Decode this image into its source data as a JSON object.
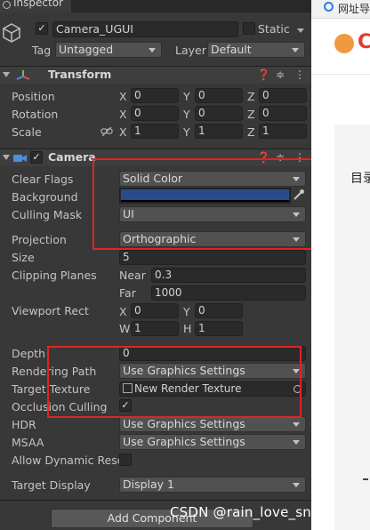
{
  "inspector": {
    "tab_label": "Inspector"
  },
  "object": {
    "name": "Camera_UGUI",
    "static_label": "Static",
    "tag_label": "Tag",
    "tag_value": "Untagged",
    "layer_label": "Layer",
    "layer_value": "Default"
  },
  "transform": {
    "title": "Transform",
    "position_label": "Position",
    "rotation_label": "Rotation",
    "scale_label": "Scale",
    "x": "X",
    "y": "Y",
    "z": "Z",
    "position": [
      "0",
      "0",
      "0"
    ],
    "rotation": [
      "0",
      "0",
      "0"
    ],
    "scale": [
      "1",
      "1",
      "1"
    ]
  },
  "camera": {
    "title": "Camera",
    "clear_flags_label": "Clear Flags",
    "clear_flags": "Solid Color",
    "background_label": "Background",
    "background_color": "#2b4a8b",
    "culling_mask_label": "Culling Mask",
    "culling_mask": "UI",
    "projection_label": "Projection",
    "projection": "Orthographic",
    "size_label": "Size",
    "size": "5",
    "clipping_label": "Clipping Planes",
    "near_label": "Near",
    "near": "0.3",
    "far_label": "Far",
    "far": "1000",
    "viewport_label": "Viewport Rect",
    "vx": "0",
    "vy": "0",
    "vw_label": "W",
    "vw": "1",
    "vh_label": "H",
    "vh": "1",
    "depth_label": "Depth",
    "depth": "0",
    "rendering_path_label": "Rendering Path",
    "rendering_path": "Use Graphics Settings",
    "target_texture_label": "Target Texture",
    "target_texture": "New Render Texture",
    "occlusion_label": "Occlusion Culling",
    "hdr_label": "HDR",
    "hdr": "Use Graphics Settings",
    "msaa_label": "MSAA",
    "msaa": "Use Graphics Settings",
    "dynamic_label": "Allow Dynamic Resol",
    "target_display_label": "Target Display",
    "target_display": "Display 1"
  },
  "add_component": "Add Component",
  "watermark": "CSDN @rain_love_snow",
  "browser": {
    "tab_text": "网址导",
    "logo_letter": "C",
    "toc_label": "目录"
  },
  "colors": {
    "highlight": "#e02424",
    "accent": "#4c8ff1"
  }
}
